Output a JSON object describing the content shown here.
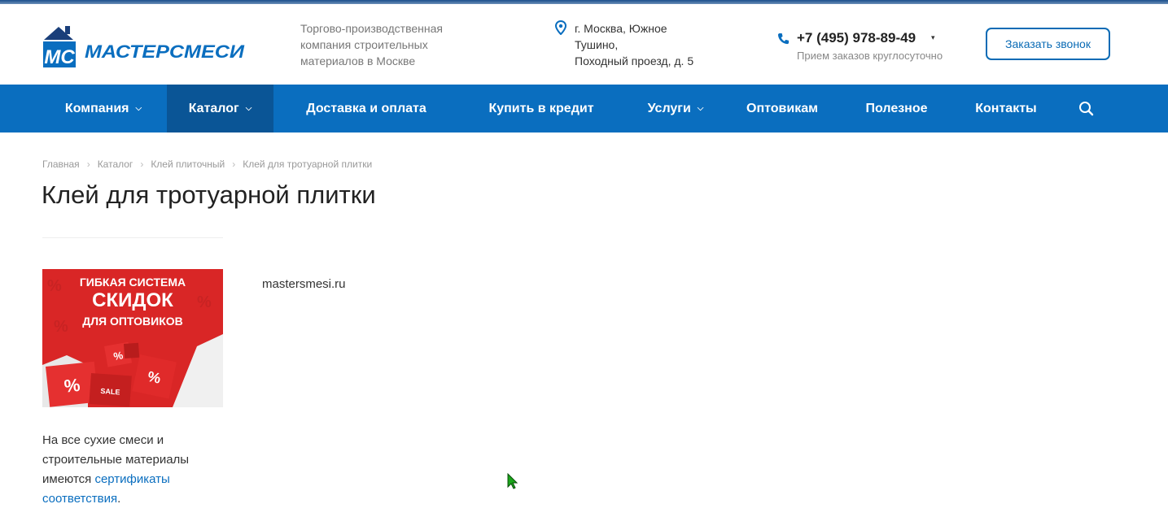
{
  "header": {
    "logo_text": "МАСТЕРСМЕСИ",
    "logo_letters": "МС",
    "tagline": "Торгово-производственная компания строительных материалов в Москве",
    "address_line1": "г. Москва, Южное",
    "address_line2": "Тушино,",
    "address_line3": "Походный проезд, д. 5",
    "phone": "+7 (495) 978-89-49",
    "phone_note": "Прием заказов круглосуточно",
    "callback_label": "Заказать звонок"
  },
  "nav": {
    "items": [
      {
        "label": "Компания",
        "has_dropdown": true
      },
      {
        "label": "Каталог",
        "has_dropdown": true,
        "active": true
      },
      {
        "label": "Доставка и оплата"
      },
      {
        "label": "Купить в кредит"
      },
      {
        "label": "Услуги",
        "has_dropdown": true
      },
      {
        "label": "Оптовикам"
      },
      {
        "label": "Полезное"
      },
      {
        "label": "Контакты"
      }
    ],
    "chevron": "⌄"
  },
  "breadcrumb": {
    "items": [
      "Главная",
      "Каталог",
      "Клей плиточный",
      "Клей для тротуарной плитки"
    ],
    "sep": "›"
  },
  "page": {
    "title": "Клей для тротуарной плитки",
    "content_text": "mastersmesi.ru"
  },
  "banner": {
    "line1": "ГИБКАЯ СИСТЕМА",
    "line2": "СКИДОК",
    "line3": "ДЛЯ ОПТОВИКОВ",
    "cube_sale": "SALE",
    "cube_pct": "%"
  },
  "sidebar": {
    "text_before": "На все сухие смеси и строительные материалы имеются ",
    "link_text": "сертификаты соответствия",
    "text_after": "."
  },
  "colors": {
    "nav_bg": "#0a6ebf",
    "nav_active": "#0a5596",
    "accent": "#0a6bb5",
    "banner_red": "#d92626"
  }
}
